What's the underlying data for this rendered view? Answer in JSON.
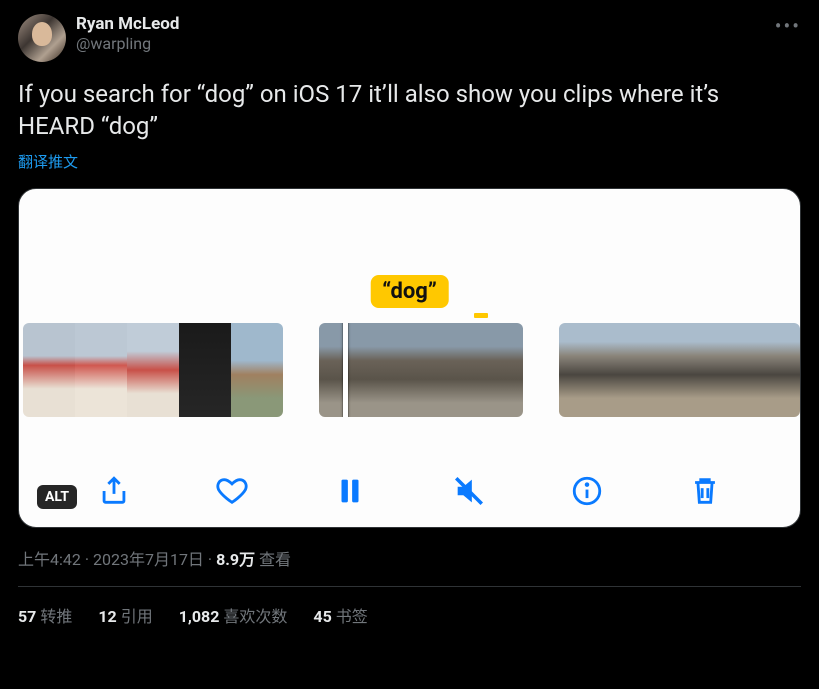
{
  "author": {
    "display_name": "Ryan McLeod",
    "handle": "@warpling"
  },
  "tweet_text": "If you search for “dog” on iOS 17 it’ll also show you clips where it’s HEARD “dog”",
  "translate_label": "翻译推文",
  "media": {
    "search_tag": "“dog”",
    "alt_label": "ALT"
  },
  "meta": {
    "time": "上午4:42",
    "sep1": " · ",
    "date": "2023年7月17日",
    "sep2": " · ",
    "views_count": "8.9万",
    "views_label": " 查看"
  },
  "stats": {
    "retweets_count": "57",
    "retweets_label": "转推",
    "quotes_count": "12",
    "quotes_label": "引用",
    "likes_count": "1,082",
    "likes_label": "喜欢次数",
    "bookmarks_count": "45",
    "bookmarks_label": "书签"
  }
}
